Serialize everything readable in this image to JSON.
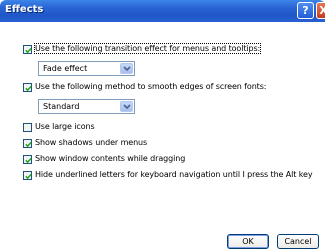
{
  "window": {
    "title": "Effects",
    "help_label": "?",
    "close_label": "X"
  },
  "options": [
    {
      "label": "Use the following transition effect for menus and tooltips:",
      "checked": true
    },
    {
      "label": "Use the following method to smooth edges of screen fonts:",
      "checked": true
    },
    {
      "label": "Use large icons",
      "checked": false
    },
    {
      "label": "Show shadows under menus",
      "checked": true
    },
    {
      "label": "Show window contents while dragging",
      "checked": true
    },
    {
      "label": "Hide underlined letters for keyboard navigation until I press the Alt key",
      "checked": true
    }
  ],
  "transition_select": {
    "value": "Fade effect"
  },
  "smoothing_select": {
    "value": "Standard"
  },
  "buttons": {
    "ok": "OK",
    "cancel": "Cancel"
  }
}
